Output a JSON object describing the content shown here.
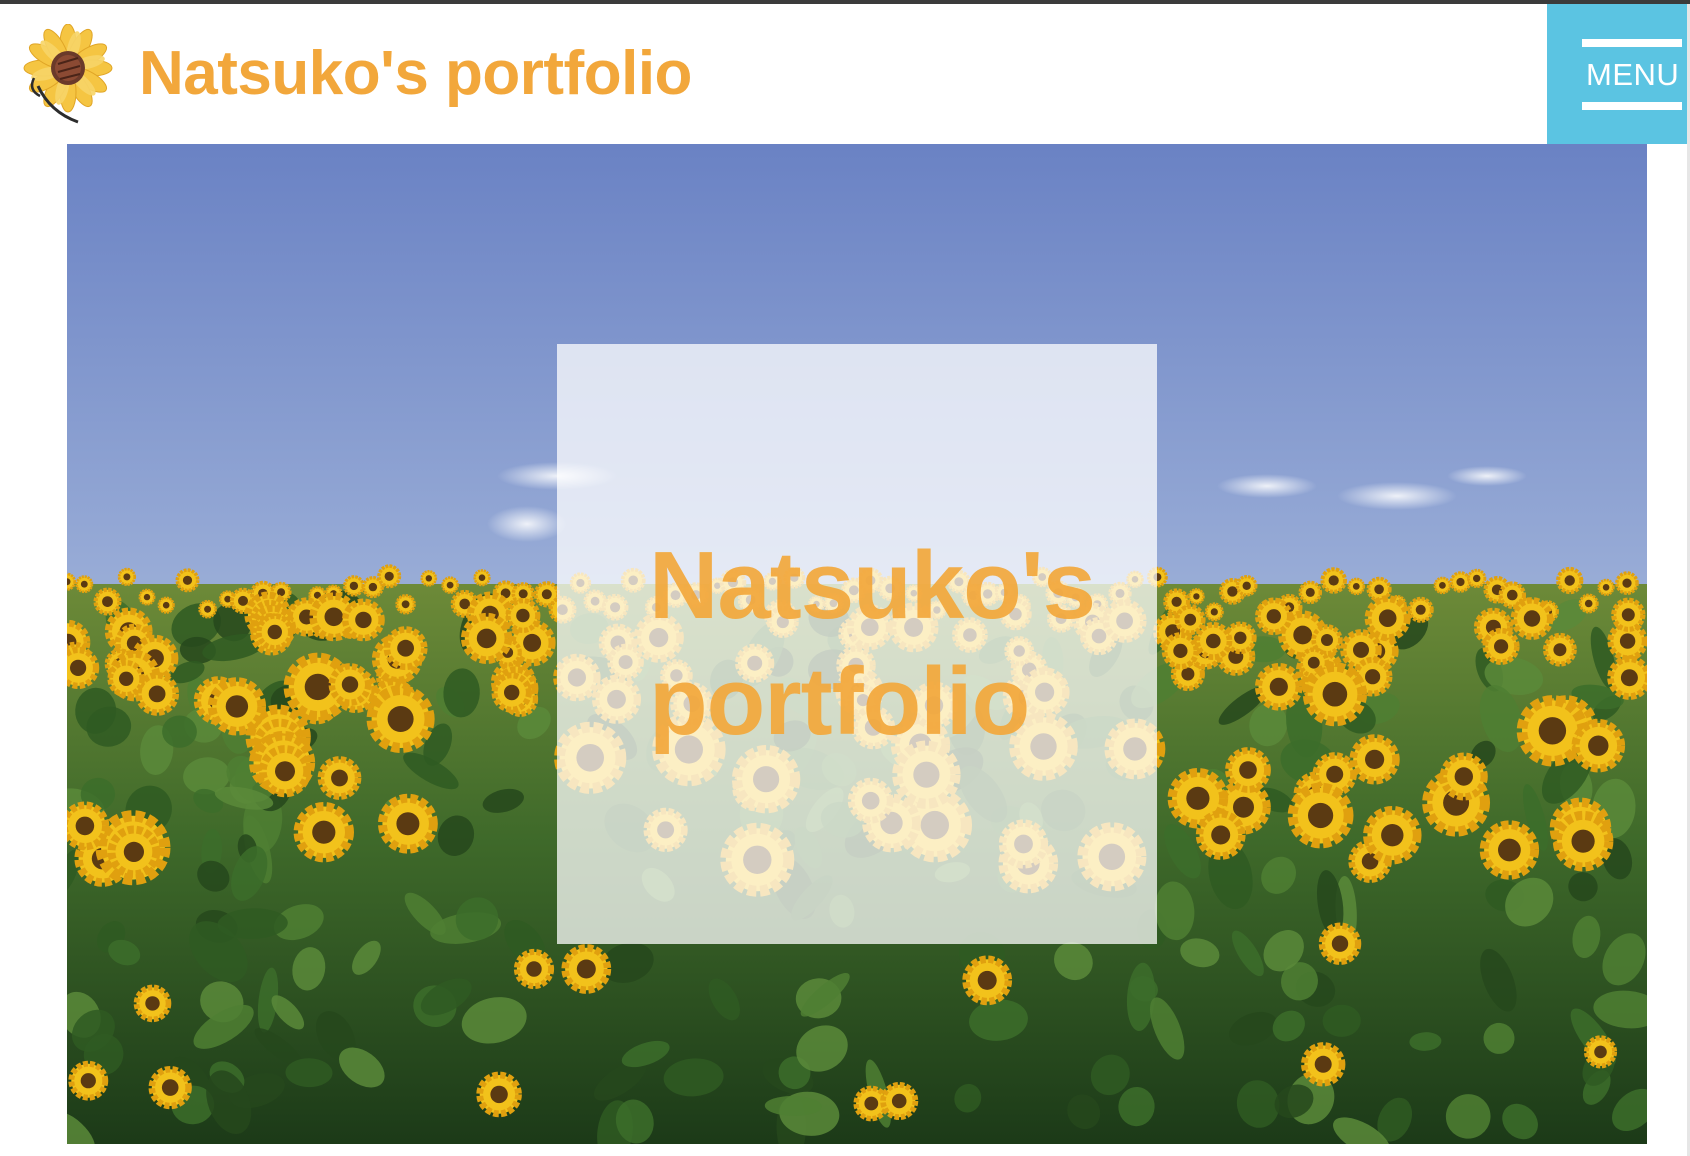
{
  "header": {
    "site_title": "Natsuko's portfolio",
    "logo_icon": "sunflower-logo-icon",
    "menu_label": "MENU"
  },
  "hero": {
    "title_line1": "Natsuko's",
    "title_line2": "portfolio",
    "background": "sunflower-field-photo"
  },
  "colors": {
    "accent": "#f2a73b",
    "menu_bg": "#5bc4e2",
    "top_border": "#3b3b3b"
  }
}
